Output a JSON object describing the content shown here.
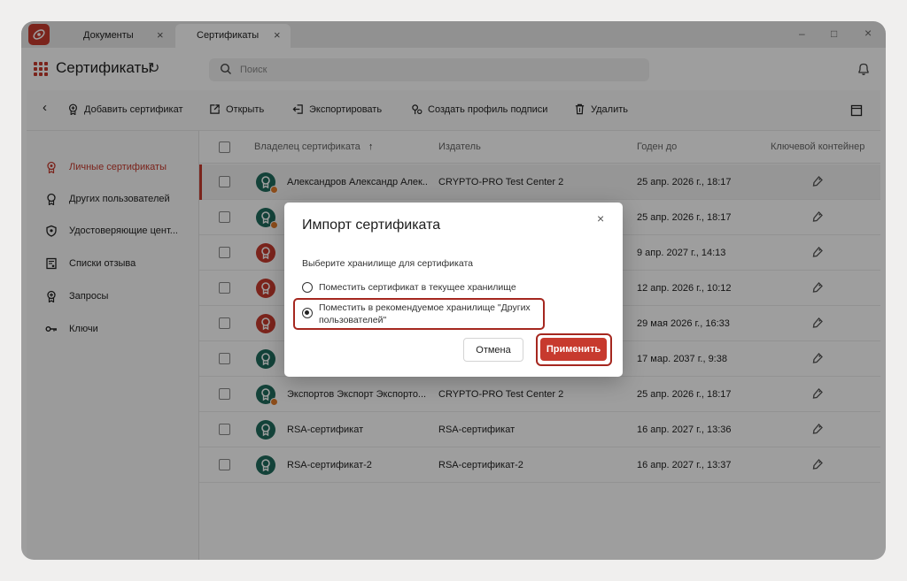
{
  "titlebar": {
    "tabs": [
      {
        "label": "Документы",
        "active": false
      },
      {
        "label": "Сертификаты",
        "active": true
      }
    ],
    "close_glyph": "×",
    "window_controls": {
      "minimize": "–",
      "maximize": "□",
      "close": "×"
    }
  },
  "header": {
    "title": "Сертификаты",
    "refresh_glyph": "↻",
    "search": {
      "placeholder": "Поиск",
      "value": ""
    }
  },
  "toolbar": {
    "back_glyph": "‹",
    "items": [
      {
        "label": "Добавить сертификат",
        "icon": "certificate-add-icon"
      },
      {
        "label": "Открыть",
        "icon": "open-external-icon"
      },
      {
        "label": "Экспортировать",
        "icon": "export-icon"
      },
      {
        "label": "Создать профиль подписи",
        "icon": "signature-profile-icon"
      },
      {
        "label": "Удалить",
        "icon": "trash-icon"
      }
    ]
  },
  "sidebar": {
    "items": [
      {
        "label": "Личные сертификаты",
        "icon": "certificate-personal-icon",
        "active": true
      },
      {
        "label": "Других пользователей",
        "icon": "certificate-others-icon",
        "active": false
      },
      {
        "label": "Удостоверяющие цент...",
        "icon": "shield-icon",
        "active": false
      },
      {
        "label": "Списки отзыва",
        "icon": "revocation-list-icon",
        "active": false
      },
      {
        "label": "Запросы",
        "icon": "certificate-request-icon",
        "active": false
      },
      {
        "label": "Ключи",
        "icon": "key-icon",
        "active": false
      }
    ]
  },
  "table": {
    "columns": {
      "owner": "Владелец сертификата",
      "sort_glyph": "↑",
      "issuer": "Издатель",
      "valid_until": "Годен до",
      "container": "Ключевой контейнер"
    },
    "rows": [
      {
        "owner": "Александров Александр Алек...",
        "issuer": "CRYPTO-PRO Test Center 2",
        "valid_until": "25 апр. 2026 г., 18:17",
        "avatar_color": "#1f6b5c",
        "badge": true
      },
      {
        "owner": "",
        "issuer": "",
        "valid_until": "25 апр. 2026 г., 18:17",
        "avatar_color": "#1f6b5c",
        "badge": true
      },
      {
        "owner": "",
        "issuer": "",
        "valid_until": "9 апр. 2027 г., 14:13",
        "avatar_color": "#c73a2e",
        "badge": false
      },
      {
        "owner": "",
        "issuer": "",
        "valid_until": "12 апр. 2026 г., 10:12",
        "avatar_color": "#c73a2e",
        "badge": false
      },
      {
        "owner": "",
        "issuer": "",
        "valid_until": "29 мая 2026 г., 16:33",
        "avatar_color": "#c73a2e",
        "badge": false
      },
      {
        "owner": "",
        "issuer": "",
        "valid_until": "17 мар. 2037 г., 9:38",
        "avatar_color": "#1f6b5c",
        "badge": false
      },
      {
        "owner": "Экспортов Экспорт Экспорто...",
        "issuer": "CRYPTO-PRO Test Center 2",
        "valid_until": "25 апр. 2026 г., 18:17",
        "avatar_color": "#1f6b5c",
        "badge": true
      },
      {
        "owner": "RSA-сертификат",
        "issuer": "RSA-сертификат",
        "valid_until": "16 апр. 2027 г., 13:36",
        "avatar_color": "#1f6b5c",
        "badge": false
      },
      {
        "owner": "RSA-сертификат-2",
        "issuer": "RSA-сертификат-2",
        "valid_until": "16 апр. 2027 г., 13:37",
        "avatar_color": "#1f6b5c",
        "badge": false
      }
    ]
  },
  "dialog": {
    "title": "Импорт сертификата",
    "close_glyph": "×",
    "prompt": "Выберите хранилище для сертификата",
    "option_current": "Поместить сертификат в текущее хранилище",
    "option_recommended": "Поместить в рекомендуемое хранилище \"Других пользователей\"",
    "selected_option": "recommended",
    "cancel_label": "Отмена",
    "apply_label": "Применить"
  },
  "colors": {
    "accent": "#c73a2e",
    "highlight_frame": "#a5271f",
    "avatar_green": "#1f6b5c",
    "badge_orange": "#e07b2a"
  }
}
